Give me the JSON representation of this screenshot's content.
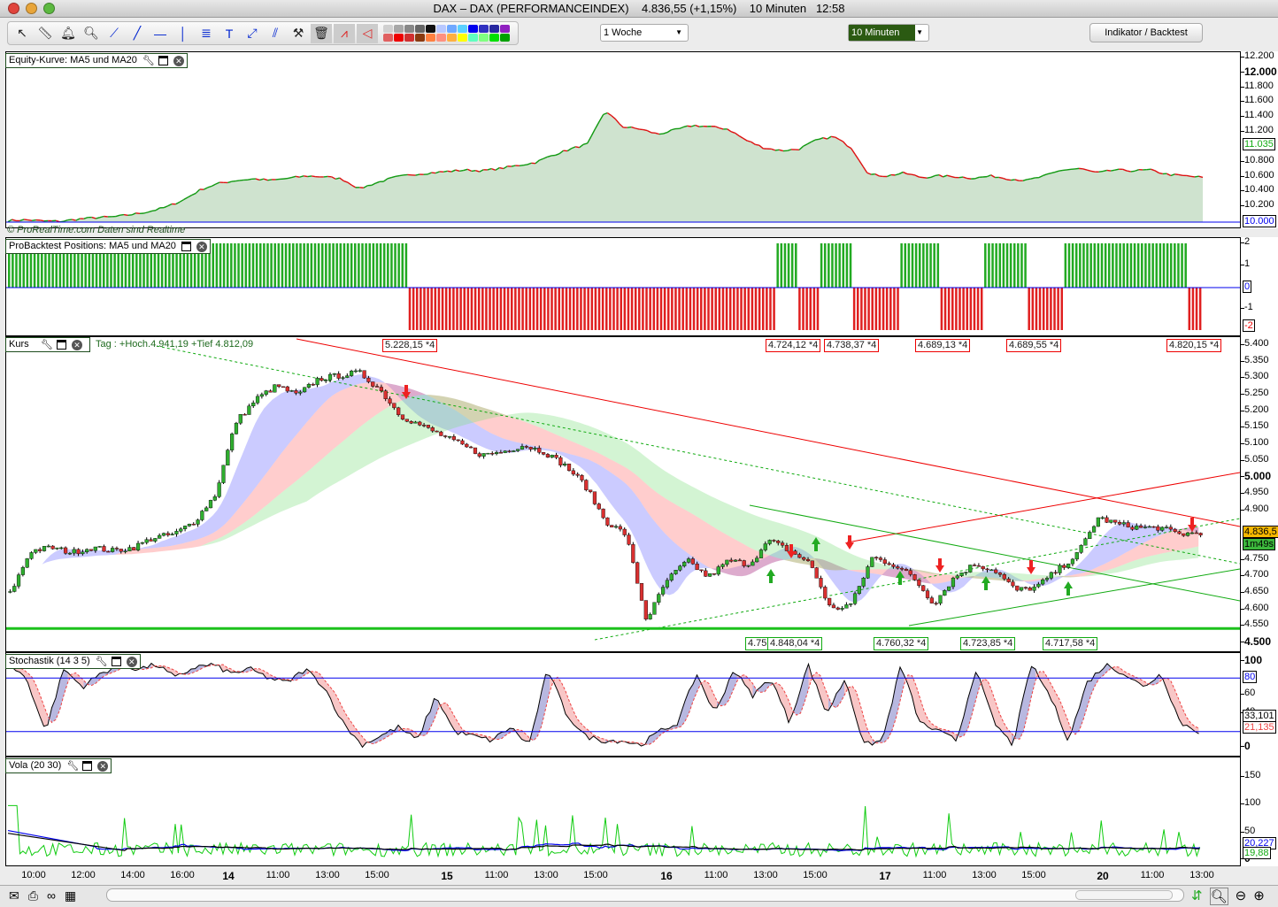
{
  "window": {
    "title": "DAX – DAX (PERFORMANCEINDEX)",
    "price": "4.836,55 (+1,15%)",
    "interval": "10 Minuten",
    "time": "12:58"
  },
  "toolbar": {
    "tools": [
      "pointer-icon",
      "ruler-icon",
      "alarm-bell-icon",
      "zoom-icon",
      "line-icon",
      "trendline-icon",
      "horizontal-line-icon",
      "vertical-line-icon",
      "indicator-icon",
      "text-icon",
      "channel-icon",
      "parallel-lines-icon",
      "tools-icon",
      "trash-icon",
      "signal-icon",
      "triangle-icon"
    ],
    "colors": [
      "#d0d0d0",
      "#a8a8a8",
      "#888888",
      "#666666",
      "#111111",
      "#b8c8ff",
      "#6fa8ff",
      "#5ad0ff",
      "#0000ee",
      "#3030c0",
      "#2828a0",
      "#9020c0",
      "#e06060",
      "#ee0000",
      "#d03030",
      "#8a3a10",
      "#ff8040",
      "#ff9080",
      "#ffb040",
      "#ffff00",
      "#60ffc0",
      "#80ff80",
      "#00e000",
      "#00a000"
    ],
    "period_select": "1 Woche",
    "interval_select": "10 Minuten",
    "indicator_button": "Indikator / Backtest"
  },
  "equity": {
    "title": "Equity-Kurve: MA5 und MA20",
    "watermark": "© ProRealTime.com  Daten sind Realtime",
    "ticks": [
      "12.200",
      "12.000",
      "11.800",
      "11.600",
      "11.400",
      "11.200",
      "10.800",
      "10.600",
      "10.400",
      "10.200"
    ],
    "current": "11.035",
    "baseline": "10.000",
    "range": [
      10000,
      12200
    ],
    "values": [
      10020,
      10030,
      10015,
      10010,
      10040,
      10060,
      10070,
      10100,
      10140,
      10200,
      10300,
      10440,
      10520,
      10560,
      10580,
      10560,
      10590,
      10620,
      10610,
      10580,
      10450,
      10530,
      10600,
      10640,
      10660,
      10680,
      10700,
      10690,
      10720,
      10760,
      10800,
      10900,
      10980,
      11050,
      11500,
      11280,
      11250,
      11180,
      11240,
      11300,
      11280,
      11250,
      11100,
      11000,
      10960,
      10980,
      11100,
      11150,
      11000,
      10640,
      10620,
      10660,
      10600,
      10620,
      10610,
      10590,
      10620,
      10580,
      10560,
      10620,
      10700,
      10720,
      10660,
      10700,
      10690,
      10700,
      10640,
      10620,
      10600
    ]
  },
  "positions": {
    "title": "ProBacktest Positions: MA5 und MA20",
    "ticks": [
      "2",
      "1",
      "-1"
    ],
    "zero": "0",
    "neg": "-2",
    "segments": [
      {
        "side": "long",
        "bars": 110
      },
      {
        "side": "short",
        "bars": 101
      },
      {
        "side": "long",
        "bars": 6
      },
      {
        "side": "short",
        "bars": 6
      },
      {
        "side": "long",
        "bars": 9
      },
      {
        "side": "short",
        "bars": 13
      },
      {
        "side": "long",
        "bars": 11
      },
      {
        "side": "short",
        "bars": 12
      },
      {
        "side": "long",
        "bars": 12
      },
      {
        "side": "short",
        "bars": 10
      },
      {
        "side": "long",
        "bars": 34
      },
      {
        "side": "short",
        "bars": 4
      }
    ]
  },
  "price": {
    "title": "Kurs",
    "info": "Tag : +Hoch.4.941,19 +Tief 4.812,09",
    "ticks": [
      "5.400",
      "5.350",
      "5.300",
      "5.250",
      "5.200",
      "5.150",
      "5.100",
      "5.050",
      "4.950",
      "4.900",
      "4.750",
      "4.700",
      "4.650",
      "4.600",
      "4.550"
    ],
    "bold_ticks": [
      "5.000",
      "4.500"
    ],
    "current": "4.836,5",
    "countdown": "1m49s",
    "range": [
      4500,
      5400
    ],
    "top_labels": [
      "5.228,15 *4",
      "4.724,12 *4",
      "4.738,37 *4",
      "4.689,13 *4",
      "4.689,55 *4",
      "4.820,15 *4"
    ],
    "bottom_labels": [
      "4.752,05 *4",
      "4.848,04 *4",
      "4.760,32 *4",
      "4.723,85 *4",
      "4.717,58 *4"
    ],
    "closes": [
      4650,
      4780,
      4790,
      4775,
      4790,
      4780,
      4790,
      4820,
      4830,
      4870,
      4950,
      5170,
      5240,
      5280,
      5250,
      5300,
      5310,
      5320,
      5270,
      5190,
      5160,
      5130,
      5100,
      5070,
      5080,
      5100,
      5080,
      5040,
      4980,
      4870,
      4830,
      4570,
      4690,
      4750,
      4700,
      4750,
      4740,
      4810,
      4780,
      4740,
      4600,
      4620,
      4760,
      4740,
      4700,
      4620,
      4700,
      4740,
      4720,
      4660,
      4670,
      4720,
      4770,
      4880,
      4860,
      4850,
      4850,
      4830,
      4836
    ],
    "support": 4545
  },
  "stochastic": {
    "title": "Stochastik (14 3 5)",
    "ticks": [
      "60",
      "40"
    ],
    "top": "100",
    "bottom": "0",
    "level": "80",
    "k_value": "33,101",
    "d_value": "21,135",
    "values": [
      95,
      80,
      20,
      90,
      70,
      85,
      95,
      90,
      95,
      80,
      92,
      95,
      85,
      90,
      80,
      75,
      90,
      70,
      30,
      5,
      15,
      25,
      10,
      60,
      20,
      15,
      10,
      25,
      5,
      90,
      40,
      15,
      10,
      10,
      5,
      20,
      30,
      85,
      40,
      90,
      60,
      80,
      30,
      95,
      40,
      80,
      5,
      10,
      95,
      30,
      20,
      10,
      90,
      30,
      5,
      95,
      60,
      10,
      75,
      95,
      85,
      70,
      85,
      30,
      20
    ]
  },
  "vola": {
    "title": "Vola (20 30)",
    "ticks": [
      "150",
      "100",
      "50"
    ],
    "bottom": "0",
    "blue_value": "20,227",
    "green_value": "19,88"
  },
  "time_axis": [
    {
      "t": "10:00"
    },
    {
      "t": "12:00"
    },
    {
      "t": "14:00"
    },
    {
      "t": "16:00"
    },
    {
      "t": "14",
      "day": true
    },
    {
      "t": "11:00"
    },
    {
      "t": "13:00"
    },
    {
      "t": "15:00"
    },
    {
      "t": "15",
      "day": true
    },
    {
      "t": "11:00"
    },
    {
      "t": "13:00"
    },
    {
      "t": "15:00"
    },
    {
      "t": "16",
      "day": true
    },
    {
      "t": "11:00"
    },
    {
      "t": "13:00"
    },
    {
      "t": "15:00"
    },
    {
      "t": "17",
      "day": true
    },
    {
      "t": "11:00"
    },
    {
      "t": "13:00"
    },
    {
      "t": "15:00"
    },
    {
      "t": "20",
      "day": true
    },
    {
      "t": "11:00"
    },
    {
      "t": "13:00"
    }
  ],
  "colors": {
    "up": "#22aa22",
    "down": "#dd2222",
    "equity_fill": "#cfe3cf",
    "accent_blue": "#0000ee"
  }
}
